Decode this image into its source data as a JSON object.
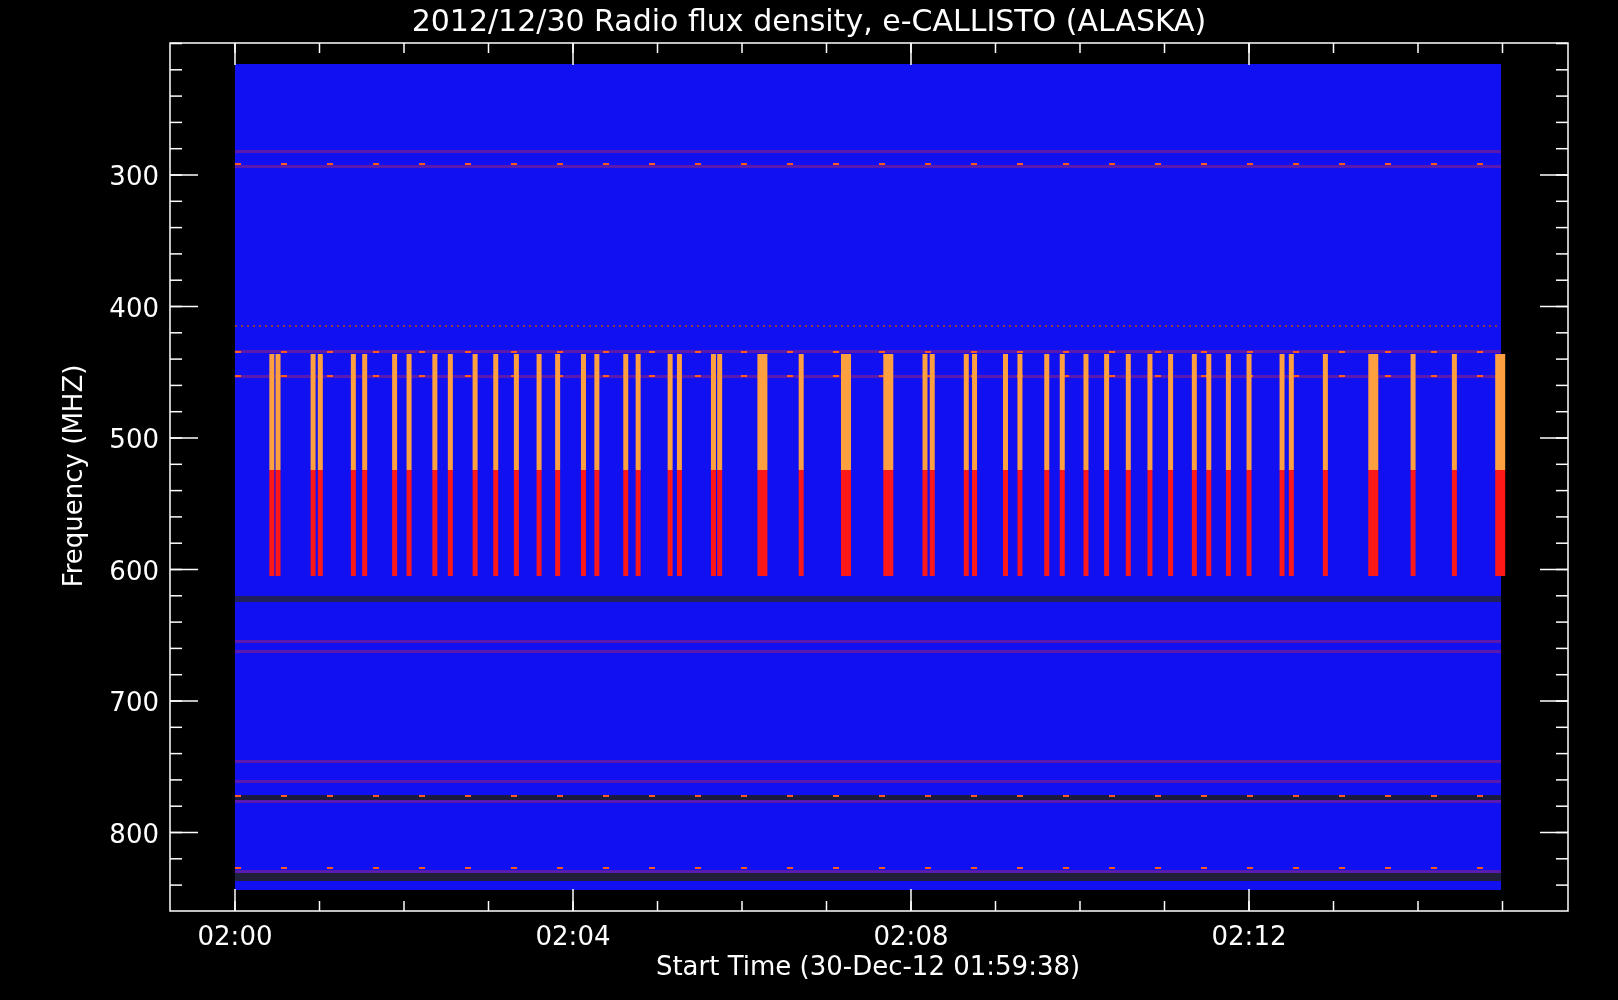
{
  "title": "2012/12/30  Radio flux density, e-CALLISTO (ALASKA)",
  "y_axis": {
    "label": "Frequency (MHZ)",
    "ticks": [
      "300",
      "400",
      "500",
      "600",
      "700",
      "800"
    ]
  },
  "x_axis": {
    "label": "Start Time (30-Dec-12 01:59:38)",
    "ticks": [
      "02:00",
      "02:04",
      "02:08",
      "02:12"
    ]
  }
}
